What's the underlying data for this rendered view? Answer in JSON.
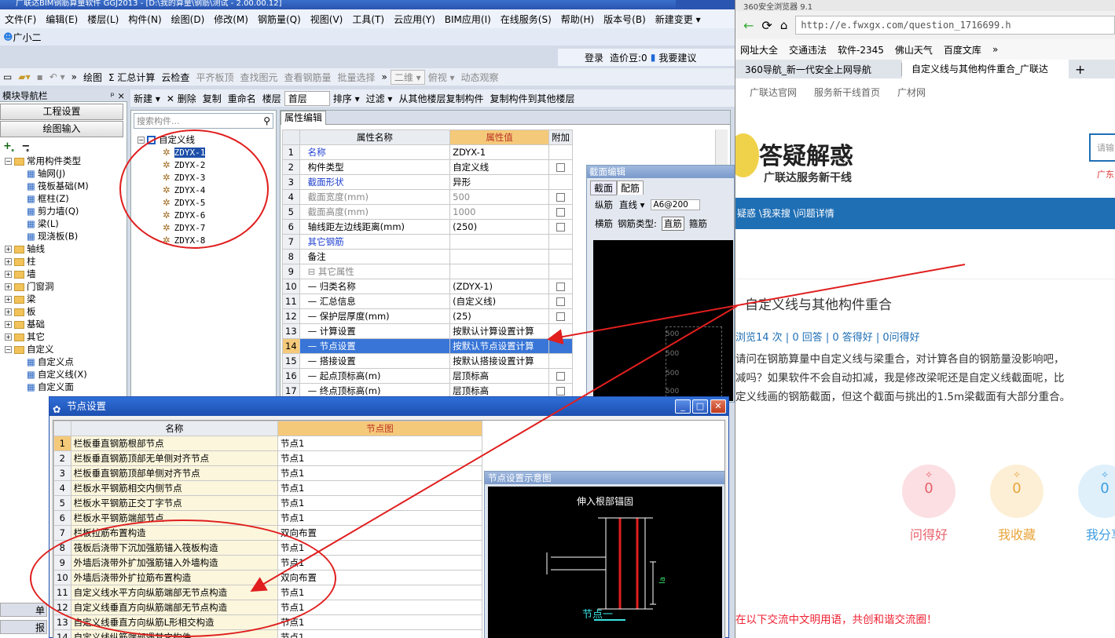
{
  "app": {
    "title": "广联达BIM钢筋算量软件 GGJ2013 - [D:\\我的算量\\钢筋\\测试 - 2.00.00.12]",
    "menu": [
      "文件(F)",
      "编辑(E)",
      "楼层(L)",
      "构件(N)",
      "绘图(D)",
      "修改(M)",
      "钢筋量(Q)",
      "视图(V)",
      "工具(T)",
      "云应用(Y)",
      "BIM应用(I)",
      "在线服务(S)",
      "帮助(H)",
      "版本号(B)",
      "新建变更 ▾"
    ],
    "user": "广小二",
    "login": "登录",
    "price": "造价豆:0",
    "suggest": "我要建议",
    "toolbar1": [
      "绘图",
      "Σ 汇总计算",
      "云检查",
      "平齐板顶",
      "查找图元",
      "查看钢筋量",
      "批量选择",
      "二维 ▾",
      "俯视 ▾",
      "动态观察"
    ],
    "toolbar2": [
      "新建 ▾",
      "✕ 删除",
      "复制",
      "重命名",
      "楼层",
      "首层",
      "排序 ▾",
      "过滤 ▾",
      "从其他楼层复制构件",
      "复制构件到其他楼层"
    ]
  },
  "nav": {
    "title": "模块导航栏",
    "pin": "ᵖ ×",
    "project_settings": "工程设置",
    "drawing_input": "绘图输入",
    "tree": [
      {
        "label": "常用构件类型",
        "level": 0,
        "exp": "−",
        "type": "folder"
      },
      {
        "label": "轴网(J)",
        "level": 1,
        "type": "icon"
      },
      {
        "label": "筏板基础(M)",
        "level": 1,
        "type": "icon"
      },
      {
        "label": "框柱(Z)",
        "level": 1,
        "type": "icon"
      },
      {
        "label": "剪力墙(Q)",
        "level": 1,
        "type": "icon"
      },
      {
        "label": "梁(L)",
        "level": 1,
        "type": "icon"
      },
      {
        "label": "现浇板(B)",
        "level": 1,
        "type": "icon"
      },
      {
        "label": "轴线",
        "level": 0,
        "exp": "+",
        "type": "folder"
      },
      {
        "label": "柱",
        "level": 0,
        "exp": "+",
        "type": "folder"
      },
      {
        "label": "墙",
        "level": 0,
        "exp": "+",
        "type": "folder"
      },
      {
        "label": "门窗洞",
        "level": 0,
        "exp": "+",
        "type": "folder"
      },
      {
        "label": "梁",
        "level": 0,
        "exp": "+",
        "type": "folder"
      },
      {
        "label": "板",
        "level": 0,
        "exp": "+",
        "type": "folder"
      },
      {
        "label": "基础",
        "level": 0,
        "exp": "+",
        "type": "folder"
      },
      {
        "label": "其它",
        "level": 0,
        "exp": "+",
        "type": "folder"
      },
      {
        "label": "自定义",
        "level": 0,
        "exp": "−",
        "type": "folder"
      },
      {
        "label": "自定义点",
        "level": 1,
        "type": "icon"
      },
      {
        "label": "自定义线(X)",
        "level": 1,
        "type": "icon"
      },
      {
        "label": "自定义面",
        "level": 1,
        "type": "icon"
      }
    ],
    "bottom1": "单",
    "bottom2": "报"
  },
  "component_list": {
    "search_placeholder": "搜索构件...",
    "root": "自定义线",
    "items": [
      "ZDYX-1",
      "ZDYX-2",
      "ZDYX-3",
      "ZDYX-4",
      "ZDYX-5",
      "ZDYX-6",
      "ZDYX-7",
      "ZDYX-8"
    ]
  },
  "property": {
    "tab": "属性编辑",
    "headers": [
      "属性名称",
      "属性值",
      "附加"
    ],
    "rows": [
      {
        "n": "1",
        "name": "名称",
        "val": "ZDYX-1",
        "chk": false,
        "blue": true
      },
      {
        "n": "2",
        "name": "构件类型",
        "val": "自定义线",
        "chk": true
      },
      {
        "n": "3",
        "name": "截面形状",
        "val": "异形",
        "chk": false,
        "blue": true
      },
      {
        "n": "4",
        "name": "截面宽度(mm)",
        "val": "500",
        "chk": true,
        "grey": true
      },
      {
        "n": "5",
        "name": "截面高度(mm)",
        "val": "1000",
        "chk": true,
        "grey": true
      },
      {
        "n": "6",
        "name": "轴线距左边线距离(mm)",
        "val": "(250)",
        "chk": true
      },
      {
        "n": "7",
        "name": "其它钢筋",
        "val": "",
        "chk": false,
        "blue": true
      },
      {
        "n": "8",
        "name": "备注",
        "val": "",
        "chk": false
      },
      {
        "n": "9",
        "name": "⊟ 其它属性",
        "val": "",
        "chk": false,
        "grey": true
      },
      {
        "n": "10",
        "name": "— 归类名称",
        "val": "(ZDYX-1)",
        "chk": true
      },
      {
        "n": "11",
        "name": "— 汇总信息",
        "val": "(自定义线)",
        "chk": true
      },
      {
        "n": "12",
        "name": "— 保护层厚度(mm)",
        "val": "(25)",
        "chk": true
      },
      {
        "n": "13",
        "name": "— 计算设置",
        "val": "按默认计算设置计算",
        "chk": false
      },
      {
        "n": "14",
        "name": "— 节点设置",
        "val": "按默认节点设置计算",
        "chk": false,
        "sel": true
      },
      {
        "n": "15",
        "name": "— 搭接设置",
        "val": "按默认搭接设置计算",
        "chk": false
      },
      {
        "n": "16",
        "name": "— 起点顶标高(m)",
        "val": "层顶标高",
        "chk": true
      },
      {
        "n": "17",
        "name": "— 终点顶标高(m)",
        "val": "层顶标高",
        "chk": true
      }
    ]
  },
  "section_editor": {
    "title": "截面编辑",
    "tabs": [
      "截面",
      "配筋"
    ],
    "row1": [
      "纵筋",
      "直线 ▾",
      "A6@200"
    ],
    "row2": [
      "横筋",
      "钢筋类型:",
      "直筋",
      "箍筋"
    ],
    "grid_labels": [
      "500",
      "500",
      "500",
      "500"
    ]
  },
  "node_dialog": {
    "title": "节点设置",
    "headers": [
      "名称",
      "节点图"
    ],
    "rows": [
      {
        "n": "1",
        "name": "栏板垂直钢筋根部节点",
        "val": "节点1"
      },
      {
        "n": "2",
        "name": "栏板垂直钢筋顶部无单侧对齐节点",
        "val": "节点1"
      },
      {
        "n": "3",
        "name": "栏板垂直钢筋顶部单侧对齐节点",
        "val": "节点1"
      },
      {
        "n": "4",
        "name": "栏板水平钢筋相交内侧节点",
        "val": "节点1"
      },
      {
        "n": "5",
        "name": "栏板水平钢筋正交丁字节点",
        "val": "节点1"
      },
      {
        "n": "6",
        "name": "栏板水平钢筋端部节点",
        "val": "节点1"
      },
      {
        "n": "7",
        "name": "栏板拉筋布置构造",
        "val": "双向布置"
      },
      {
        "n": "8",
        "name": "筏板后浇带下沉加强筋锚入筏板构造",
        "val": "节点1"
      },
      {
        "n": "9",
        "name": "外墙后浇带外扩加强筋锚入外墙构造",
        "val": "节点1"
      },
      {
        "n": "10",
        "name": "外墙后浇带外扩拉筋布置构造",
        "val": "双向布置"
      },
      {
        "n": "11",
        "name": "自定义线水平方向纵筋端部无节点构造",
        "val": "节点1"
      },
      {
        "n": "12",
        "name": "自定义线垂直方向纵筋端部无节点构造",
        "val": "节点1"
      },
      {
        "n": "13",
        "name": "自定义线垂直方向纵筋L形相交构造",
        "val": "节点1"
      },
      {
        "n": "14",
        "name": "自定义线纵筋端部遇其它构件",
        "val": "节点1"
      }
    ],
    "diagram_title": "节点设置示意图",
    "diagram_caption": "伸入根部锚固",
    "diagram_label": "节点一",
    "diagram_dim": "la"
  },
  "browser": {
    "title": "360安全浏览器 9.1",
    "url": "http://e.fwxgx.com/question_1716699.h",
    "bookmarks": [
      "网址大全",
      "交通违法",
      "软件-2345",
      "佛山天气",
      "百度文库",
      "»"
    ],
    "tabs": [
      "360导航_新一代安全上网导航",
      "自定义线与其他构件重合_广联达"
    ],
    "links": [
      "广联达官网",
      "服务新干线首页",
      "广材网"
    ],
    "logo": "答疑解惑",
    "logo_sub": "广联达服务新干线",
    "search_placeholder": "请输",
    "region": "广东",
    "breadcrumb": "疑惑 \\我来搜 \\问题详情",
    "question_title": "自定义线与其他构件重合",
    "stats": "浏览14 次 | 0 回答 | 0 答得好 | 0问得好",
    "body_lines": [
      "请问在钢筋算量中自定义线与梁重合，对计算各自的钢筋量没影响吧，",
      "减吗？如果软件不会自动扣减，我是修改梁呢还是自定义线截面呢，比",
      "定义线画的钢筋截面，但这个截面与挑出的1.5m梁截面有大部分重合。"
    ],
    "actions": [
      {
        "label": "问得好",
        "count": "0",
        "color": "#e8616b",
        "bg": "#fbdfe2"
      },
      {
        "label": "我收藏",
        "count": "0",
        "color": "#e8a43a",
        "bg": "#fcefd6"
      },
      {
        "label": "我分享",
        "count": "0",
        "color": "#3d9de0",
        "bg": "#dff0fb"
      }
    ],
    "footer_note": "在以下交流中文明用语，共创和谐交流圈！"
  },
  "colors": {
    "annotation_red": "#e01e1e",
    "accent_blue": "#1e4fa8",
    "header_orange": "#f5c97a"
  }
}
